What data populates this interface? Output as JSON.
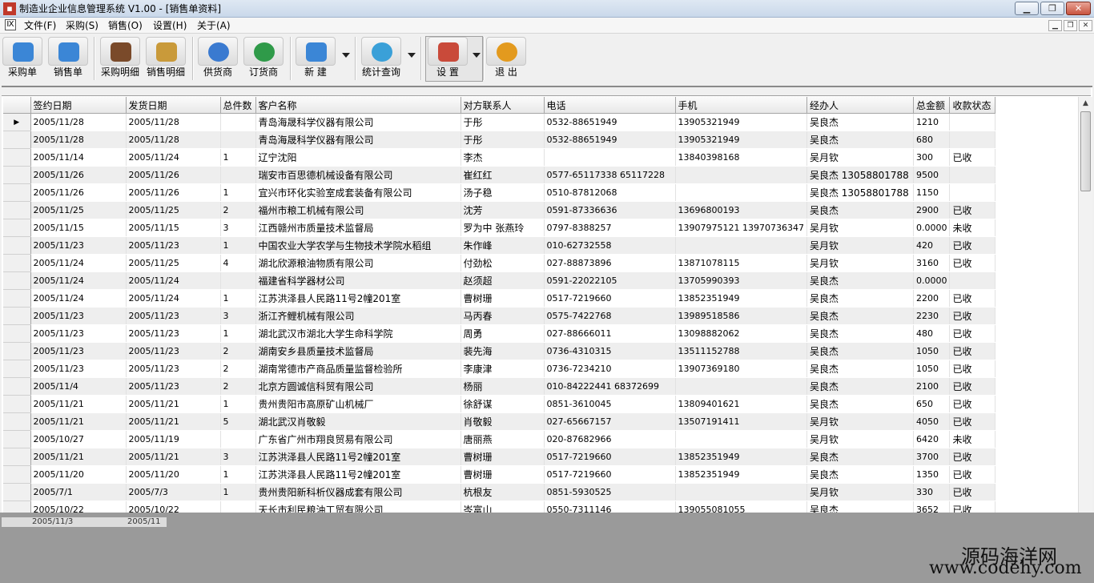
{
  "window": {
    "title": "制造业企业信息管理系统 V1.00 - [销售单资料]",
    "minimize": "▁",
    "restore": "❐",
    "close": "✕"
  },
  "menu": {
    "icon": "Ⅸ",
    "items": [
      "文件(F)",
      "采购(S)",
      "销售(O)",
      "设置(H)",
      "关于(A)"
    ],
    "mdi_buttons": [
      "▁",
      "❐",
      "✕"
    ]
  },
  "toolbar": {
    "buttons": [
      {
        "label": "采购单",
        "icon": "folder-purchase-icon",
        "color": "#3b86d6"
      },
      {
        "label": "销售单",
        "icon": "folder-sales-icon",
        "color": "#3b86d6"
      },
      {
        "label": "采购明细",
        "icon": "purchase-detail-icon",
        "color": "#7a4a2a"
      },
      {
        "label": "销售明细",
        "icon": "sales-detail-icon",
        "color": "#c99a3a"
      },
      {
        "label": "供货商",
        "icon": "supplier-icon",
        "color": "#3a7ad0"
      },
      {
        "label": "订货商",
        "icon": "customer-icon",
        "color": "#2f9a49"
      },
      {
        "label": "新 建",
        "icon": "new-icon",
        "color": "#3b86d6"
      },
      {
        "label": "统计查询",
        "icon": "statistics-icon",
        "color": "#3aa0d8"
      },
      {
        "label": "设 置",
        "icon": "settings-icon",
        "color": "#c94a3a"
      },
      {
        "label": "退 出",
        "icon": "exit-icon",
        "color": "#e39a1e"
      }
    ]
  },
  "grid": {
    "columns": [
      "签约日期",
      "发货日期",
      "总件数",
      "客户名称",
      "对方联系人",
      "电话",
      "手机",
      "经办人",
      "总金额",
      "收款状态"
    ],
    "current_row_marker": "▶",
    "rows": [
      [
        "2005/11/28",
        "2005/11/28",
        "",
        "青岛海晟科学仪器有限公司",
        "于彤",
        "0532-88651949",
        "13905321949",
        "吴良杰",
        "1210",
        ""
      ],
      [
        "2005/11/28",
        "2005/11/28",
        "",
        "青岛海晟科学仪器有限公司",
        "于彤",
        "0532-88651949",
        "13905321949",
        "吴良杰",
        "680",
        ""
      ],
      [
        "2005/11/14",
        "2005/11/24",
        "1",
        "辽宁沈阳",
        "李杰",
        "",
        "13840398168",
        "吴月钦",
        "300",
        "已收"
      ],
      [
        "2005/11/26",
        "2005/11/26",
        "",
        "瑞安市百思德机械设备有限公司",
        "崔红红",
        "0577-65117338    65117228",
        "",
        "吴良杰    13058801788",
        "9500",
        ""
      ],
      [
        "2005/11/26",
        "2005/11/26",
        "1",
        "宜兴市环化实验室成套装备有限公司",
        "汤子稳",
        "0510-87812068",
        "",
        "吴良杰    13058801788",
        "1150",
        ""
      ],
      [
        "2005/11/25",
        "2005/11/25",
        "2",
        "福州市粮工机械有限公司",
        "沈芳",
        "0591-87336636",
        "13696800193",
        "吴良杰",
        "2900",
        "已收"
      ],
      [
        "2005/11/15",
        "2005/11/15",
        "3",
        "江西赣州市质量技术监督局",
        "罗为中 张燕玲",
        "0797-8388257",
        "13907975121 13970736347",
        "吴月钦",
        "0.0000",
        "未收"
      ],
      [
        "2005/11/23",
        "2005/11/23",
        "1",
        "中国农业大学农学与生物技术学院水稻组",
        "朱作峰",
        "010-62732558",
        "",
        "吴月钦",
        "420",
        "已收"
      ],
      [
        "2005/11/24",
        "2005/11/25",
        "4",
        "湖北欣源粮油物质有限公司",
        "付劲松",
        "027-88873896",
        "13871078115",
        "吴月钦",
        "3160",
        "已收"
      ],
      [
        "2005/11/24",
        "2005/11/24",
        "",
        "福建省科学器材公司",
        "赵须超",
        "0591-22022105",
        "13705990393",
        "吴良杰",
        "0.0000",
        ""
      ],
      [
        "2005/11/24",
        "2005/11/24",
        "1",
        "江苏洪泽县人民路11号2幢201室",
        "曹树珊",
        "0517-7219660",
        "13852351949",
        "吴良杰",
        "2200",
        "已收"
      ],
      [
        "2005/11/23",
        "2005/11/23",
        "3",
        "浙江齐鲤机械有限公司",
        "马丙春",
        "0575-7422768",
        "13989518586",
        "吴良杰",
        "2230",
        "已收"
      ],
      [
        "2005/11/23",
        "2005/11/23",
        "1",
        "湖北武汉市湖北大学生命科学院",
        "周勇",
        "027-88666011",
        "13098882062",
        "吴良杰",
        "480",
        "已收"
      ],
      [
        "2005/11/23",
        "2005/11/23",
        "2",
        "湖南安乡县质量技术监督局",
        "裴先海",
        "0736-4310315",
        "13511152788",
        "吴良杰",
        "1050",
        "已收"
      ],
      [
        "2005/11/23",
        "2005/11/23",
        "2",
        "湖南常德市产商品质量监督检验所",
        "李康津",
        "0736-7234210",
        "13907369180",
        "吴良杰",
        "1050",
        "已收"
      ],
      [
        "2005/11/4",
        "2005/11/23",
        "2",
        "北京方圆诚信科贸有限公司",
        "杨丽",
        "010-84222441    68372699",
        "",
        "吴良杰",
        "2100",
        "已收"
      ],
      [
        "2005/11/21",
        "2005/11/21",
        "1",
        "贵州贵阳市高原矿山机械厂",
        "徐舒谋",
        "0851-3610045",
        "13809401621",
        "吴良杰",
        "650",
        "已收"
      ],
      [
        "2005/11/21",
        "2005/11/21",
        "5",
        "湖北武汉肖敬毅",
        "肖敬毅",
        "027-65667157",
        "13507191411",
        "吴月钦",
        "4050",
        "已收"
      ],
      [
        "2005/10/27",
        "2005/11/19",
        "",
        "广东省广州市翔良贸易有限公司",
        "唐丽燕",
        "020-87682966",
        "",
        "吴月钦",
        "6420",
        "未收"
      ],
      [
        "2005/11/21",
        "2005/11/21",
        "3",
        "江苏洪泽县人民路11号2幢201室",
        "曹树珊",
        "0517-7219660",
        "13852351949",
        "吴良杰",
        "3700",
        "已收"
      ],
      [
        "2005/11/20",
        "2005/11/20",
        "1",
        "江苏洪泽县人民路11号2幢201室",
        "曹树珊",
        "0517-7219660",
        "13852351949",
        "吴良杰",
        "1350",
        "已收"
      ],
      [
        "2005/7/1",
        "2005/7/3",
        "1",
        "贵州贵阳新科析仪器成套有限公司",
        "杭根友",
        "0851-5930525",
        "",
        "吴月钦",
        "330",
        "已收"
      ],
      [
        "2005/10/22",
        "2005/10/22",
        "",
        "天长市利民粮油工贸有限公司",
        "岑富山",
        "0550-7311146",
        "139055081055",
        "吴良杰",
        "3652",
        "已收"
      ]
    ],
    "partial_row": [
      "2005/11/3",
      "2005/11"
    ]
  },
  "watermark": {
    "line1": "源码海洋网",
    "line2": "www.codehy.com"
  }
}
